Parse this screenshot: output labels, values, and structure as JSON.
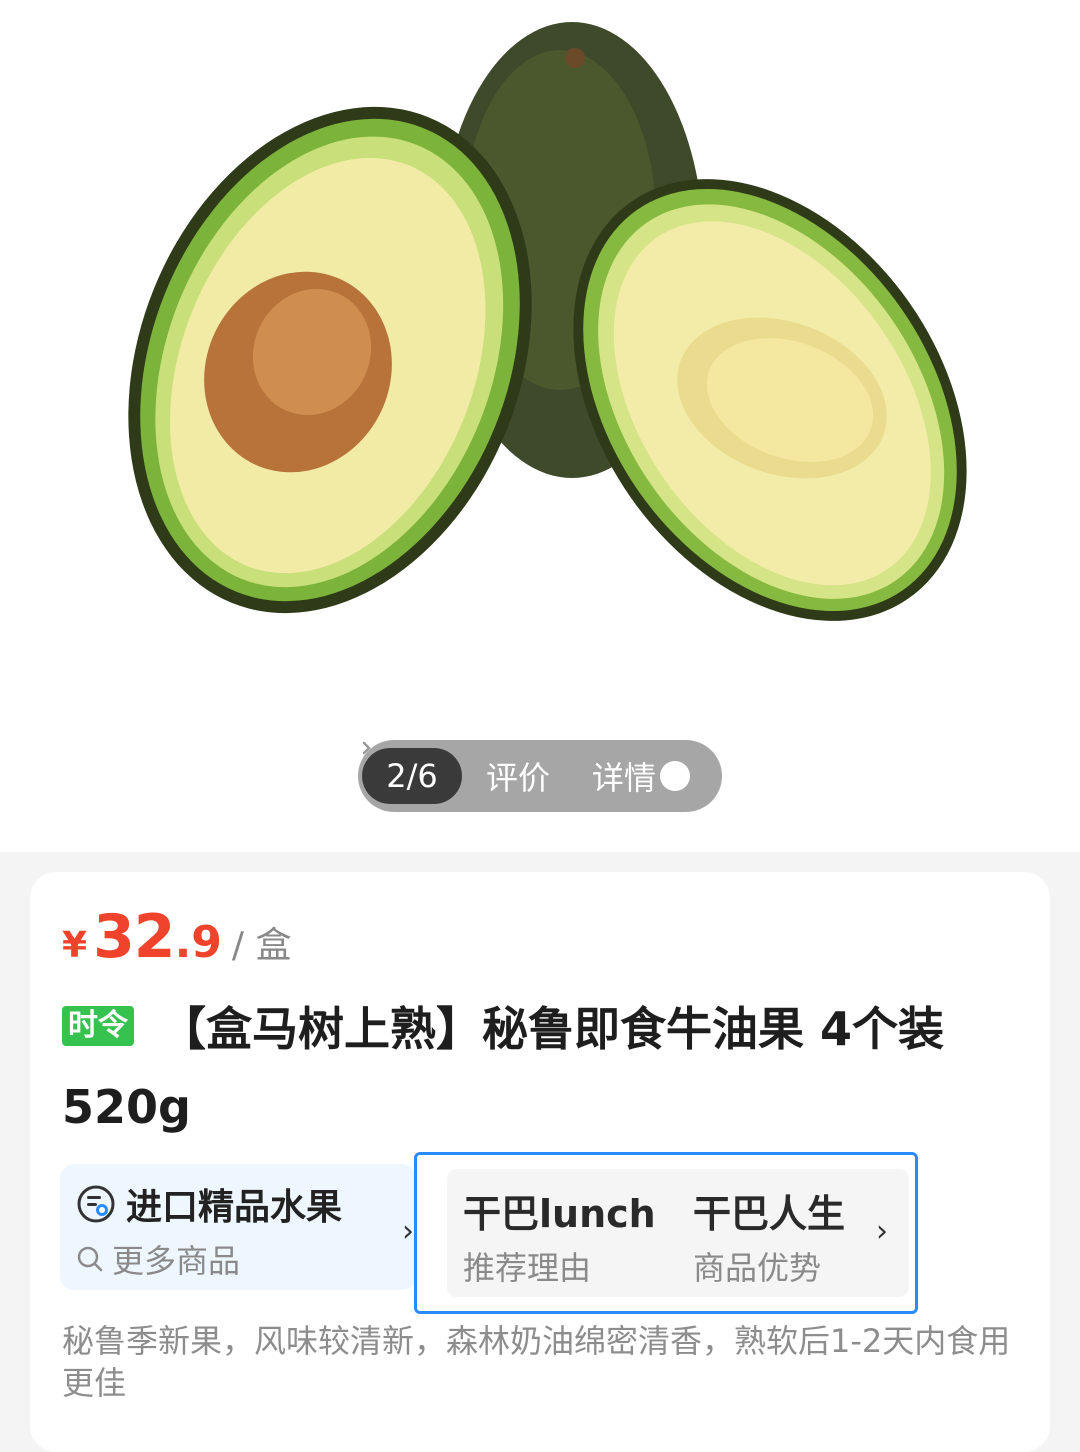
{
  "gallery": {
    "counter": "2/6",
    "tab_review": "评价",
    "tab_detail": "详情",
    "image_subject": "avocado-halves"
  },
  "product": {
    "price_symbol": "¥",
    "price_int": "32",
    "price_dec": ".9",
    "price_unit": "/ 盒",
    "badge": "时令",
    "title": "【盒马树上熟】秘鲁即食牛油果 4个装 520g",
    "description": "秘鲁季新果，风味较清新，森林奶油绵密清香，熟软后1-2天内食用更佳"
  },
  "category": {
    "title": "进口精品水果",
    "more": "更多商品"
  },
  "recommend": {
    "items": [
      {
        "main": "干巴lunch",
        "sub": "推荐理由"
      },
      {
        "main": "干巴人生",
        "sub": "商品优势"
      }
    ]
  },
  "colors": {
    "price": "#f0432b",
    "badge": "#35c24e",
    "highlight_border": "#2a8bff"
  }
}
